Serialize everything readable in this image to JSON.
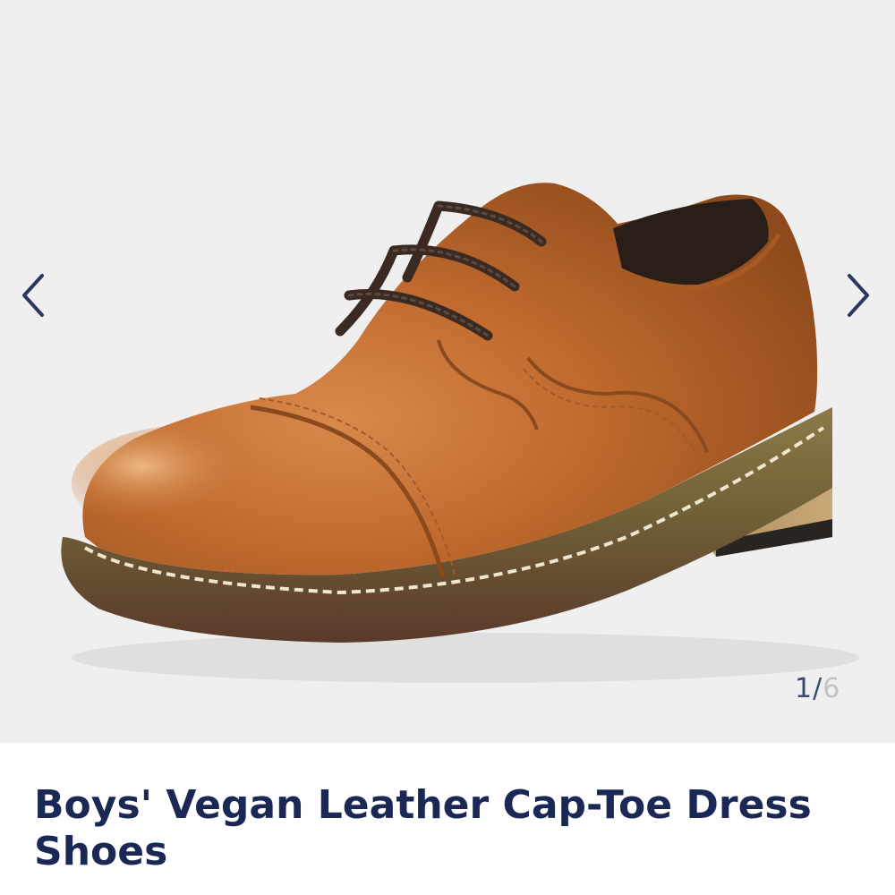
{
  "gallery": {
    "image_alt": "Boys' Vegan Leather Cap-Toe Dress Shoes",
    "current_index": "1",
    "separator": "/",
    "total_images": "6",
    "prev_icon": "chevron-left-icon",
    "next_icon": "chevron-right-icon"
  },
  "product": {
    "title": "Boys' Vegan Leather Cap-Toe Dress Shoes"
  },
  "colors": {
    "gallery_bg": "#efefef",
    "title": "#1b2855",
    "arrow": "#2b3760",
    "counter_current": "#3a4a6a",
    "counter_total": "#c3c3c3",
    "leather": "#b8622a",
    "sole": "#7a6a3c"
  }
}
